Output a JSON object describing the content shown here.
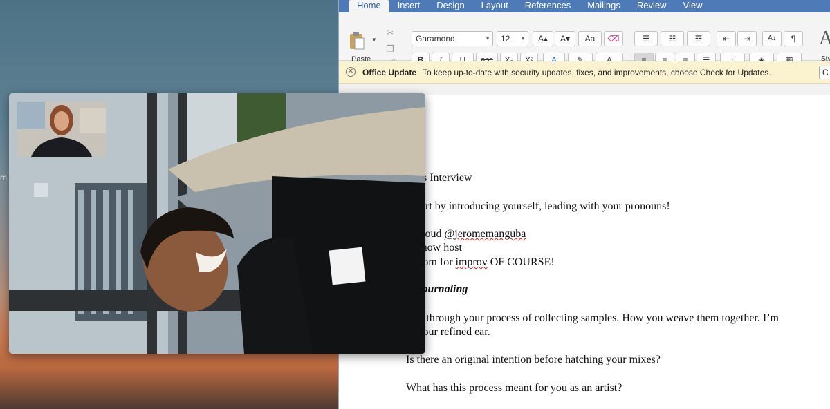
{
  "desktop": {
    "edge_label": "m"
  },
  "word": {
    "tabs": [
      "Home",
      "Insert",
      "Design",
      "Layout",
      "References",
      "Mailings",
      "Review",
      "View"
    ],
    "active_tab": "Home",
    "ribbon": {
      "paste_label": "Paste",
      "font_name": "Garamond",
      "font_size": "12",
      "styles_label": "Sty",
      "buttons": {
        "bold": "B",
        "italic": "I",
        "underline": "U",
        "strike": "abc",
        "subscript": "X₂",
        "superscript": "X²",
        "grow_font": "A▴",
        "shrink_font": "A▾",
        "change_case": "Aa",
        "show_marks": "¶",
        "sort": "A↓"
      }
    },
    "update_bar": {
      "title": "Office Update",
      "message": "To keep up-to-date with security updates, fixes, and improvements, choose Check for Updates.",
      "button_label": "C"
    },
    "document": {
      "lines": [
        "me’s Interview",
        "s start by introducing yourself, leading with your pronouns!",
        "io show host",
        "e room for ",
        "ic Journaling",
        "e us through your process of collecting samples. How you weave them together. I’m",
        "ut your refined ear.",
        "Is there an original intention before hatching your mixes?",
        "What has this process meant for you as an artist?"
      ],
      "soundcloud_prefix": "ndcloud ",
      "soundcloud_handle": "@jeromemanguba",
      "improv_word": "improv",
      "improv_suffix": " OF COURSE!"
    }
  },
  "video_call": {
    "participants": [
      "remote-participant",
      "self-view"
    ]
  },
  "colors": {
    "ribbon_tab_bar": "#4f7ab8",
    "update_bar_bg": "#fbf2cf",
    "font_color_swatch": "#e02b2b",
    "highlight_swatch": "#f5e51c"
  }
}
